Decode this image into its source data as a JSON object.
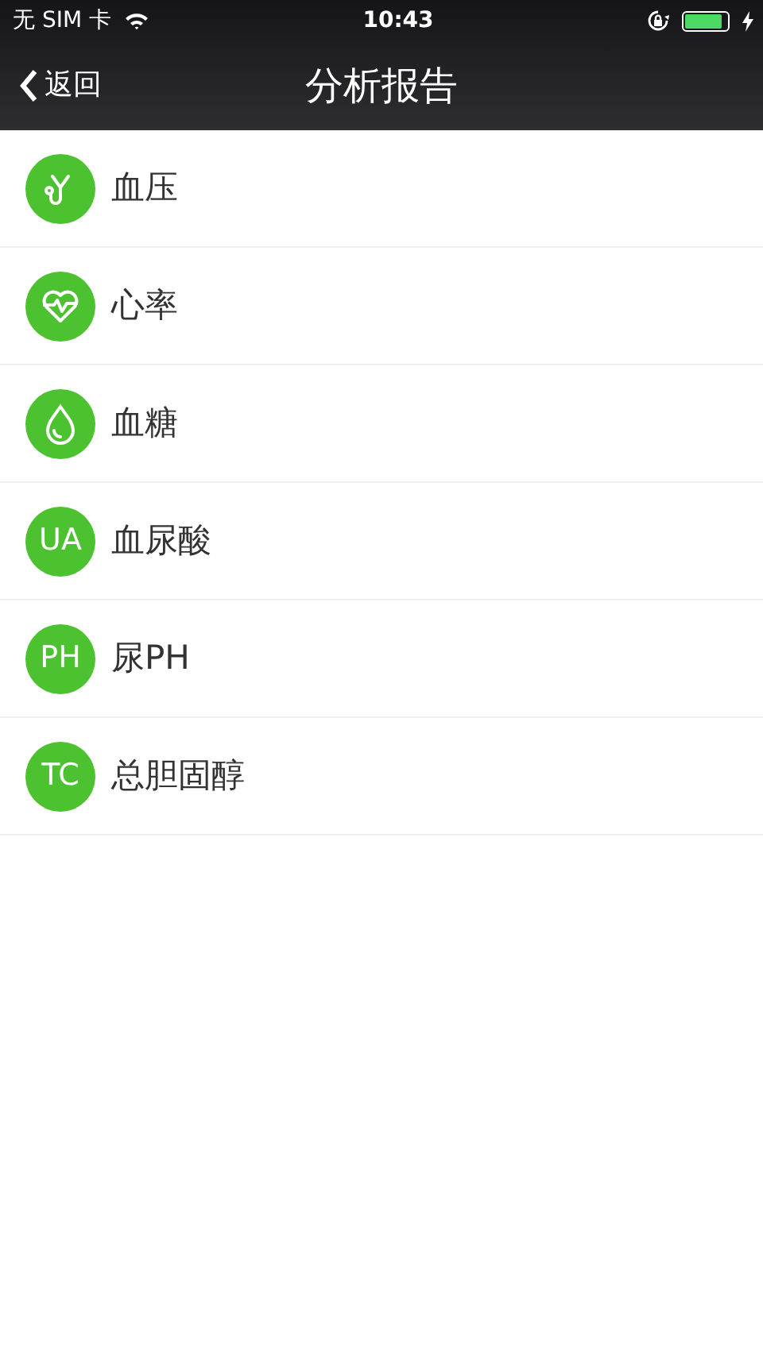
{
  "status_bar": {
    "carrier": "无 SIM 卡",
    "time": "10:43"
  },
  "nav_bar": {
    "back": "返回",
    "title": "分析报告"
  },
  "items": [
    {
      "kind": "icon",
      "label": "血压"
    },
    {
      "kind": "icon",
      "label": "心率"
    },
    {
      "kind": "icon",
      "label": "血糖"
    },
    {
      "kind": "letters",
      "badge": "UA",
      "label": "血尿酸"
    },
    {
      "kind": "letters",
      "badge": "PH",
      "label": "尿PH"
    },
    {
      "kind": "letters",
      "badge": "TC",
      "label": "总胆固醇"
    }
  ]
}
